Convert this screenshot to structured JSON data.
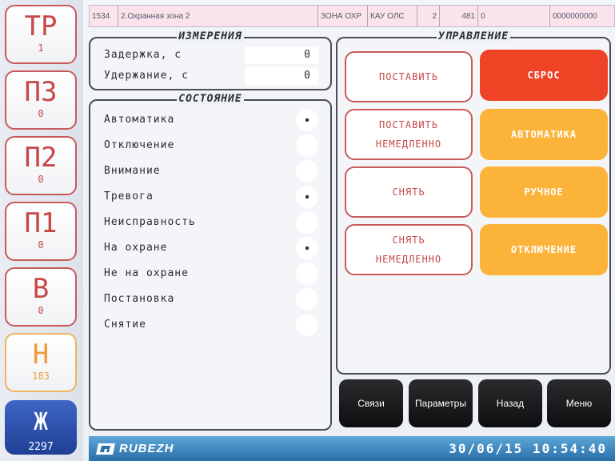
{
  "sidebar": {
    "items": [
      {
        "code": "ТР",
        "count": "1"
      },
      {
        "code": "ПЗ",
        "count": "0"
      },
      {
        "code": "П2",
        "count": "0"
      },
      {
        "code": "П1",
        "count": "0"
      },
      {
        "code": "В",
        "count": "0"
      },
      {
        "code": "Н",
        "count": "183"
      },
      {
        "code": "Ж",
        "count": "2297"
      }
    ]
  },
  "header": {
    "zone_id": "1534",
    "zone_name": "2.Охранная зона 2",
    "zone_type": "ЗОНА ОХР",
    "device": "КАУ ОЛС",
    "device_num": "2",
    "address": "481",
    "sub": "0",
    "code": "0000000000"
  },
  "measurements": {
    "title": "ИЗМЕРЕНИЯ",
    "rows": [
      {
        "label": "Задержка, с",
        "value": "0"
      },
      {
        "label": "Удержание, с",
        "value": "0"
      }
    ]
  },
  "state": {
    "title": "СОСТОЯНИЕ",
    "rows": [
      {
        "label": "Автоматика",
        "on": true
      },
      {
        "label": "Отключение",
        "on": false
      },
      {
        "label": "Внимание",
        "on": false
      },
      {
        "label": "Тревога",
        "on": true
      },
      {
        "label": "Неисправность",
        "on": false
      },
      {
        "label": "На охране",
        "on": true
      },
      {
        "label": "Не на охране",
        "on": false
      },
      {
        "label": "Постановка",
        "on": false
      },
      {
        "label": "Снятие",
        "on": false
      }
    ]
  },
  "control": {
    "title": "УПРАВЛЕНИЕ",
    "arm_label": "ПОСТАВИТЬ",
    "arm_now_l1": "ПОСТАВИТЬ",
    "arm_now_l2": "НЕМЕДЛЕННО",
    "disarm_label": "СНЯТЬ",
    "disarm_now_l1": "СНЯТЬ",
    "disarm_now_l2": "НЕМЕДЛЕННО",
    "reset_label": "СБРОС",
    "auto_label": "АВТОМАТИКА",
    "manual_label": "РУЧНОЕ",
    "disable_label": "ОТКЛЮЧЕНИЕ"
  },
  "nav": {
    "links": "Связи",
    "params": "Параметры",
    "back": "Назад",
    "menu": "Меню"
  },
  "footer": {
    "brand": "RUBEZH",
    "datetime": "30/06/15 10:54:40"
  },
  "colors": {
    "accent_red": "#ef4325",
    "accent_yellow": "#fcb33a",
    "outline_red": "#c85a5a",
    "brand_blue": "#2c6fa9"
  }
}
